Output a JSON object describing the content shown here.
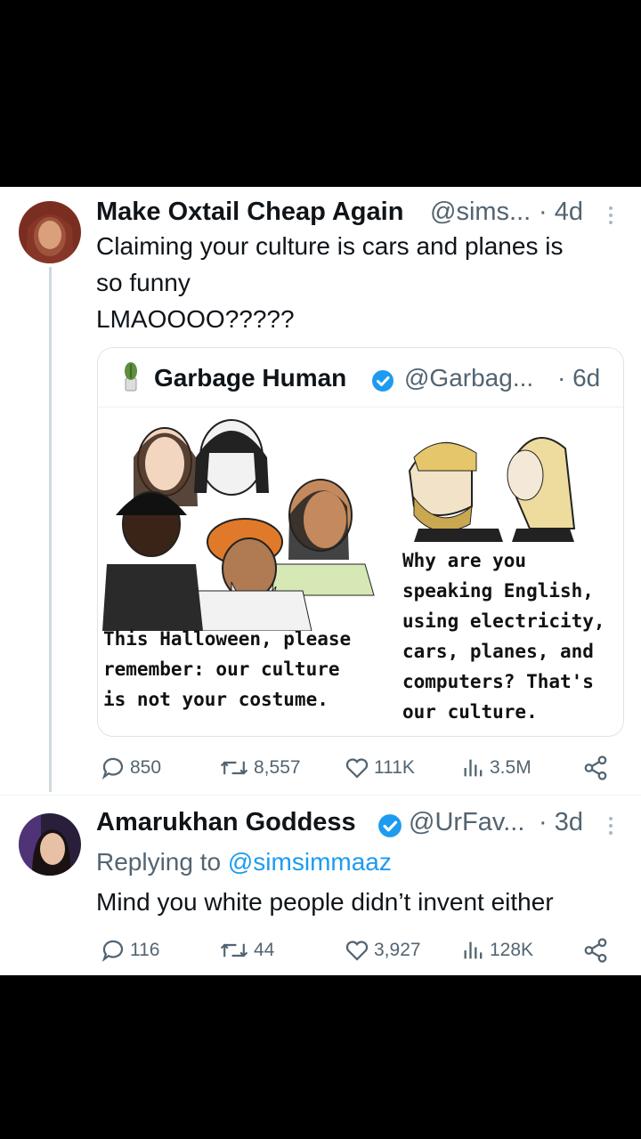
{
  "tweet1": {
    "display_name": "Make Oxtail Cheap Again",
    "handle": "@sims...",
    "time": "· 4d",
    "text_line1": "Claiming your culture is cars and planes is",
    "text_line2": "so funny",
    "text_line3": "LMAOOOO?????",
    "stats": {
      "replies": "850",
      "reposts": "8,557",
      "likes": "111K",
      "views": "3.5M"
    }
  },
  "quote": {
    "display_name": "Garbage Human",
    "handle": "@Garbag...",
    "time": "· 6d",
    "meme_left": [
      "This Halloween, please",
      "remember: our culture",
      "is not your costume."
    ],
    "meme_right": [
      "Why are you",
      "speaking English,",
      "using electricity,",
      "cars, planes, and",
      "computers? That's",
      "our culture."
    ]
  },
  "tweet2": {
    "display_name": "Amarukhan Goddess",
    "handle": "@UrFav...",
    "time": "· 3d",
    "replying_prefix": "Replying to",
    "replying_handle": "@simsimmaaz",
    "text": "Mind you white people didn’t invent either",
    "stats": {
      "replies": "116",
      "reposts": "44",
      "likes": "3,927",
      "views": "128K"
    }
  },
  "colors": {
    "verified": "#1d9bf0",
    "link": "#1d9bf0",
    "secondary_text": "#536471"
  }
}
